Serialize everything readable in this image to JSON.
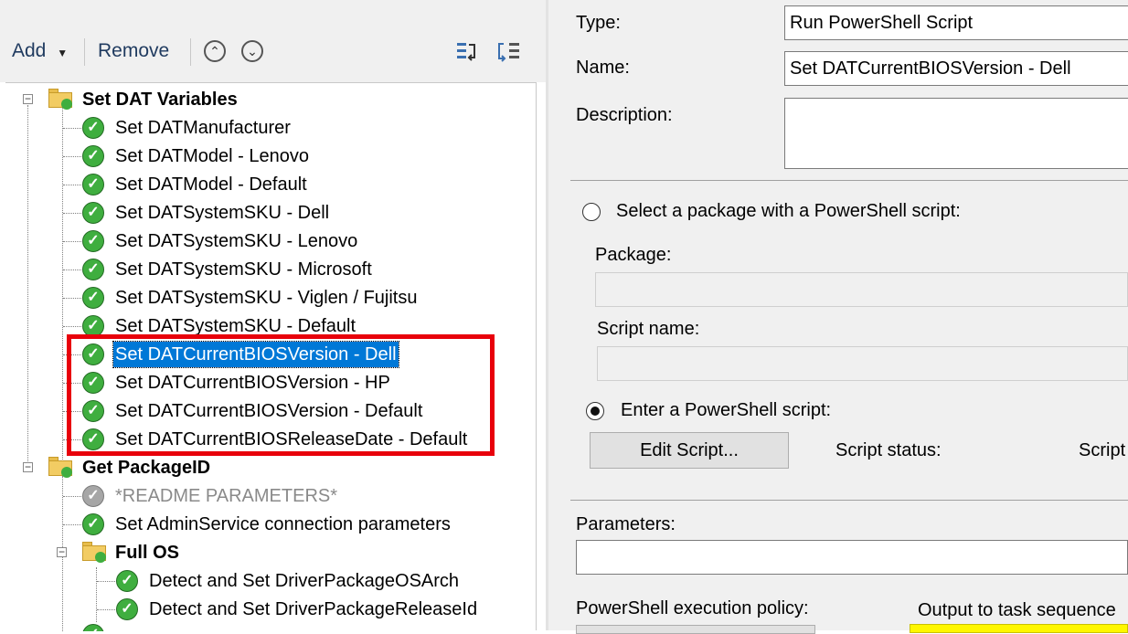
{
  "toolbar": {
    "add_label": "Add",
    "remove_label": "Remove"
  },
  "tree": {
    "groups": [
      {
        "label": "Set DAT Variables"
      },
      {
        "label": "Get PackageID"
      },
      {
        "label": "Full OS"
      }
    ],
    "steps": [
      {
        "label": "Set DATManufacturer"
      },
      {
        "label": "Set DATModel - Lenovo"
      },
      {
        "label": "Set DATModel - Default"
      },
      {
        "label": "Set DATSystemSKU - Dell"
      },
      {
        "label": "Set DATSystemSKU - Lenovo"
      },
      {
        "label": "Set DATSystemSKU - Microsoft"
      },
      {
        "label": "Set DATSystemSKU - Viglen / Fujitsu"
      },
      {
        "label": "Set DATSystemSKU - Default"
      },
      {
        "label": "Set DATCurrentBIOSVersion - Dell"
      },
      {
        "label": "Set DATCurrentBIOSVersion - HP"
      },
      {
        "label": "Set DATCurrentBIOSVersion - Default"
      },
      {
        "label": "Set DATCurrentBIOSReleaseDate - Default"
      },
      {
        "label": "*README PARAMETERS*"
      },
      {
        "label": "Set AdminService connection parameters"
      },
      {
        "label": "Detect and Set DriverPackageOSArch"
      },
      {
        "label": "Detect and Set DriverPackageReleaseId"
      }
    ],
    "selected_step": "Set DATCurrentBIOSVersion - Dell"
  },
  "properties": {
    "type_label": "Type:",
    "type_value": "Run PowerShell Script",
    "name_label": "Name:",
    "name_value": "Set DATCurrentBIOSVersion - Dell",
    "description_label": "Description:",
    "description_value": "",
    "option_package_label": "Select a package with a PowerShell script:",
    "package_label": "Package:",
    "package_value": "",
    "script_name_label": "Script name:",
    "script_name_value": "",
    "option_enter_label": "Enter a PowerShell script:",
    "edit_script_label": "Edit Script...",
    "script_status_label": "Script status:",
    "script_status_value": "Script",
    "parameters_label": "Parameters:",
    "parameters_value": "",
    "execution_policy_label": "PowerShell execution policy:",
    "output_label": "Output to task sequence"
  },
  "colors": {
    "selection": "#0078d7",
    "highlight_box": "#e8000b",
    "success_check": "#3fae3f",
    "output_field": "#fff700"
  }
}
